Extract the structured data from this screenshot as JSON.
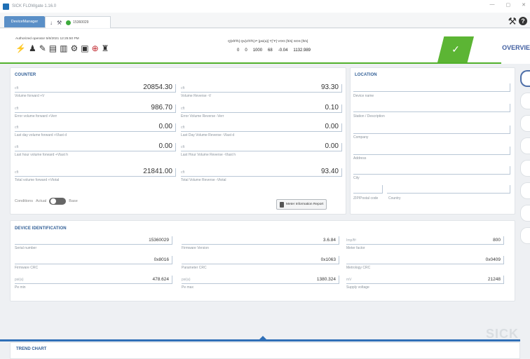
{
  "window": {
    "title": "SICK FLOWgate 1.16.0"
  },
  "tabs": {
    "device_manager": "DeviceManager",
    "device_serial": "15360029"
  },
  "operator": {
    "text": "Authorized operator 5/6/2021 12:25:50 PM"
  },
  "measurements": {
    "headers": "Q[sft³/h]  Qv[cft³/h]  P [psi(a)]  T[°F]  VOG [ft/s]  SOS [ft/s]",
    "values": [
      "0",
      "0",
      "1000",
      "68",
      "-0.04",
      "1132.989"
    ]
  },
  "overview_label": "OVERVIE",
  "counter": {
    "title": "COUNTER",
    "left": [
      {
        "unit": "cft",
        "value": "20854.30",
        "label": "Volume forward +V"
      },
      {
        "unit": "cft",
        "value": "986.70",
        "label": "Error volume forward +Verr"
      },
      {
        "unit": "cft",
        "value": "0.00",
        "label": "Last day volume forward +Vlast d"
      },
      {
        "unit": "cft",
        "value": "0.00",
        "label": "Last hour volume forward +Vlast h"
      },
      {
        "unit": "cft",
        "value": "21841.00",
        "label": "Total volume forward +Vtotal"
      }
    ],
    "right": [
      {
        "unit": "cft",
        "value": "93.30",
        "label": "Volume Reverse -V"
      },
      {
        "unit": "cft",
        "value": "0.10",
        "label": "Error Volume Reverse -Verr"
      },
      {
        "unit": "cft",
        "value": "0.00",
        "label": "Last Day Volume Reverse -Vlast d"
      },
      {
        "unit": "cft",
        "value": "0.00",
        "label": "Last Hour Volume Reverse -Vlast h"
      },
      {
        "unit": "cft",
        "value": "93.40",
        "label": "Total Volume Reverse -Vtotal"
      }
    ],
    "conditions_label": "Conditions",
    "actual_label": "Actual",
    "base_label": "Base",
    "report_button": "Meter Information Report"
  },
  "location": {
    "title": "LOCATION",
    "fields": [
      "Device name",
      "Station / Description",
      "Company",
      "Address",
      "City"
    ],
    "zip_label": "ZIP/Postal code",
    "country_label": "Country"
  },
  "device": {
    "title": "DEVICE IDENTIFICATION",
    "col1": [
      {
        "unit": "",
        "value": "15360029",
        "label": "Serial number"
      },
      {
        "unit": "",
        "value": "0x8016",
        "label": "Firmware CRC"
      },
      {
        "unit": "psi(a)",
        "value": "478.624",
        "label": "Pe min"
      }
    ],
    "col2": [
      {
        "unit": "",
        "value": "3.6.84",
        "label": "Firmware Version"
      },
      {
        "unit": "",
        "value": "0x1063",
        "label": "Parameter CRC"
      },
      {
        "unit": "psi(a)",
        "value": "1380.324",
        "label": "Pe max"
      }
    ],
    "col3": [
      {
        "unit": "Imp/ft³",
        "value": "800",
        "label": "Meter factor"
      },
      {
        "unit": "",
        "value": "0x0409",
        "label": "Metrology CRC"
      },
      {
        "unit": "mV",
        "value": "21248",
        "label": "Supply voltage"
      }
    ]
  },
  "trend": {
    "title": "TREND CHART"
  },
  "logo": "SICK"
}
